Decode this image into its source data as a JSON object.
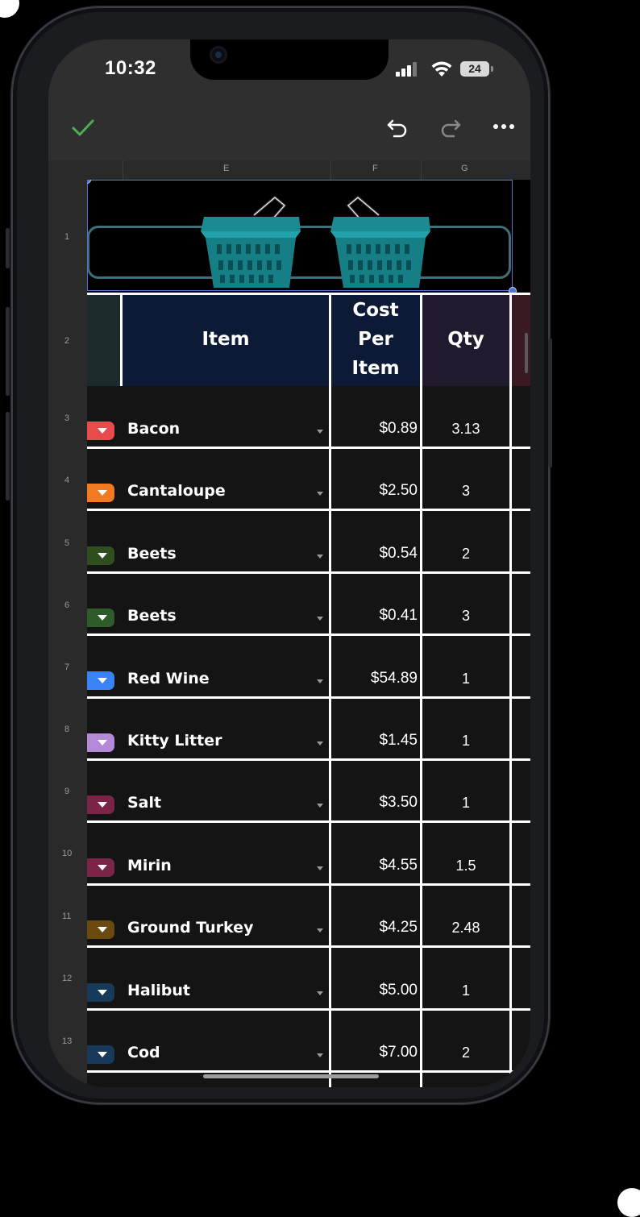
{
  "status_bar": {
    "time": "10:32",
    "battery_level": "24"
  },
  "toolbar": {
    "confirm_icon": "checkmark-icon",
    "undo_icon": "undo-icon",
    "redo_icon": "redo-icon",
    "more_icon": "more-horizontal-icon",
    "confirm_color": "#4caf50"
  },
  "sheet": {
    "columns": [
      "E",
      "F",
      "G"
    ],
    "header": {
      "item": "Item",
      "cost_line1": "Cost",
      "cost_line2": "Per",
      "cost_line3": "Item",
      "qty": "Qty"
    },
    "row_numbers": [
      "1",
      "2",
      "3",
      "4",
      "5",
      "6",
      "7",
      "8",
      "9",
      "10",
      "11",
      "12",
      "13"
    ],
    "rows": [
      {
        "item": "Bacon",
        "cost": "$0.89",
        "qty": "3.13",
        "chip_color": "#e84b4b"
      },
      {
        "item": "Cantaloupe",
        "cost": "$2.50",
        "qty": "3",
        "chip_color": "#f47a21"
      },
      {
        "item": "Beets",
        "cost": "$0.54",
        "qty": "2",
        "chip_color": "#2f4f1f"
      },
      {
        "item": "Beets",
        "cost": "$0.41",
        "qty": "3",
        "chip_color": "#2f5a2a"
      },
      {
        "item": "Red Wine",
        "cost": "$54.89",
        "qty": "1",
        "chip_color": "#3b82f6"
      },
      {
        "item": "Kitty Litter",
        "cost": "$1.45",
        "qty": "1",
        "chip_color": "#b48ad8"
      },
      {
        "item": "Salt",
        "cost": "$3.50",
        "qty": "1",
        "chip_color": "#7a2448"
      },
      {
        "item": "Mirin",
        "cost": "$4.55",
        "qty": "1.5",
        "chip_color": "#7a2448"
      },
      {
        "item": "Ground Turkey",
        "cost": "$4.25",
        "qty": "2.48",
        "chip_color": "#6b4a10"
      },
      {
        "item": "Halibut",
        "cost": "$5.00",
        "qty": "1",
        "chip_color": "#173a5a"
      },
      {
        "item": "Cod",
        "cost": "$7.00",
        "qty": "2",
        "chip_color": "#173a5a"
      }
    ],
    "image_icon": "shopping-basket-icon",
    "image_color": "#1b8a91"
  }
}
